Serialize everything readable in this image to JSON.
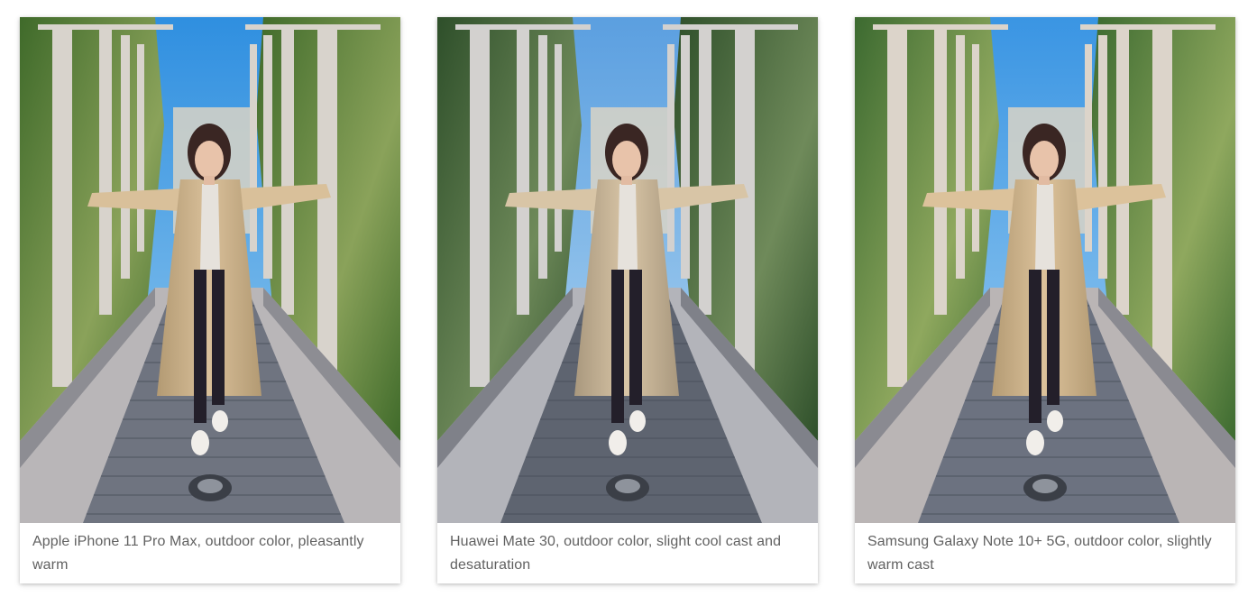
{
  "gallery": {
    "items": [
      {
        "caption": "Apple iPhone 11 Pro Max, outdoor color, pleasantly warm",
        "photo_subject": "woman-in-trench-coat-on-garden-walkway",
        "tone": {
          "sky_top": "#2f8fe0",
          "sky_bottom": "#9fd0f0",
          "foliage": "#3f6a2a",
          "foliage_light": "#8aa25a",
          "coat": "#d9c09a",
          "coat_shadow": "#b39a73",
          "wall": "#b9b6b8",
          "wall_shadow": "#8d8d93",
          "grate": "#6f7480",
          "post": "#d8d3cc"
        }
      },
      {
        "caption": "Huawei Mate 30, outdoor color, slight cool cast and desaturation",
        "photo_subject": "woman-in-trench-coat-on-garden-walkway",
        "tone": {
          "sky_top": "#5b9fe0",
          "sky_bottom": "#b9dcf3",
          "foliage": "#2e4f2a",
          "foliage_light": "#6f8a5a",
          "coat": "#d8c5a6",
          "coat_shadow": "#a9987e",
          "wall": "#b3b4ba",
          "wall_shadow": "#7f8189",
          "grate": "#5e6470",
          "post": "#d3d1cf"
        }
      },
      {
        "caption": "Samsung Galaxy Note 10+ 5G, outdoor color, slightly warm cast",
        "photo_subject": "woman-in-trench-coat-on-garden-walkway",
        "tone": {
          "sky_top": "#3a95e3",
          "sky_bottom": "#a8d4f2",
          "foliage": "#3c6a30",
          "foliage_light": "#8fa85e",
          "coat": "#dcc29b",
          "coat_shadow": "#b49b74",
          "wall": "#bab5b5",
          "wall_shadow": "#8a8a91",
          "grate": "#6c7280",
          "post": "#dcd4ca"
        }
      }
    ]
  }
}
